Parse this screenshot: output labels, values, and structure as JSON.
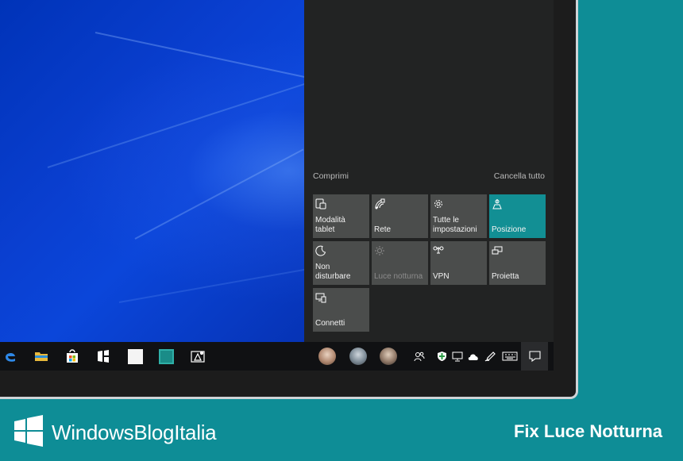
{
  "action_center": {
    "collapse_label": "Comprimi",
    "clear_all_label": "Cancella tutto",
    "tiles": [
      {
        "label": "Modalità tablet",
        "icon": "tablet-mode-icon",
        "state": "off"
      },
      {
        "label": "Rete",
        "icon": "network-icon",
        "state": "off"
      },
      {
        "label": "Tutte le\nimpostazioni",
        "icon": "gear-icon",
        "state": "off"
      },
      {
        "label": "Posizione",
        "icon": "location-icon",
        "state": "on"
      },
      {
        "label": "Non disturbare",
        "icon": "moon-icon",
        "state": "off"
      },
      {
        "label": "Luce notturna",
        "icon": "sun-icon",
        "state": "disabled"
      },
      {
        "label": "VPN",
        "icon": "vpn-icon",
        "state": "off"
      },
      {
        "label": "Proietta",
        "icon": "project-icon",
        "state": "off"
      },
      {
        "label": "Connetti",
        "icon": "connect-icon",
        "state": "off"
      }
    ]
  },
  "taskbar": {
    "apps": [
      "edge-icon",
      "file-explorer-icon",
      "store-icon",
      "app-icon",
      "blank-app-icon",
      "teal-app-icon",
      "paint-icon"
    ],
    "tray_icons": [
      "people-icon",
      "defender-icon",
      "network-monitor-icon",
      "onedrive-icon",
      "pen-icon",
      "keyboard-icon",
      "notification-icon"
    ]
  },
  "branding": {
    "site_name": "WindowsBlogItalia",
    "caption": "Fix Luce Notturna"
  },
  "colors": {
    "accent": "#128f94",
    "background": "#0e8d96",
    "tile": "#4b4d4c",
    "action_center_bg": "#222323",
    "taskbar_bg": "#101113"
  }
}
